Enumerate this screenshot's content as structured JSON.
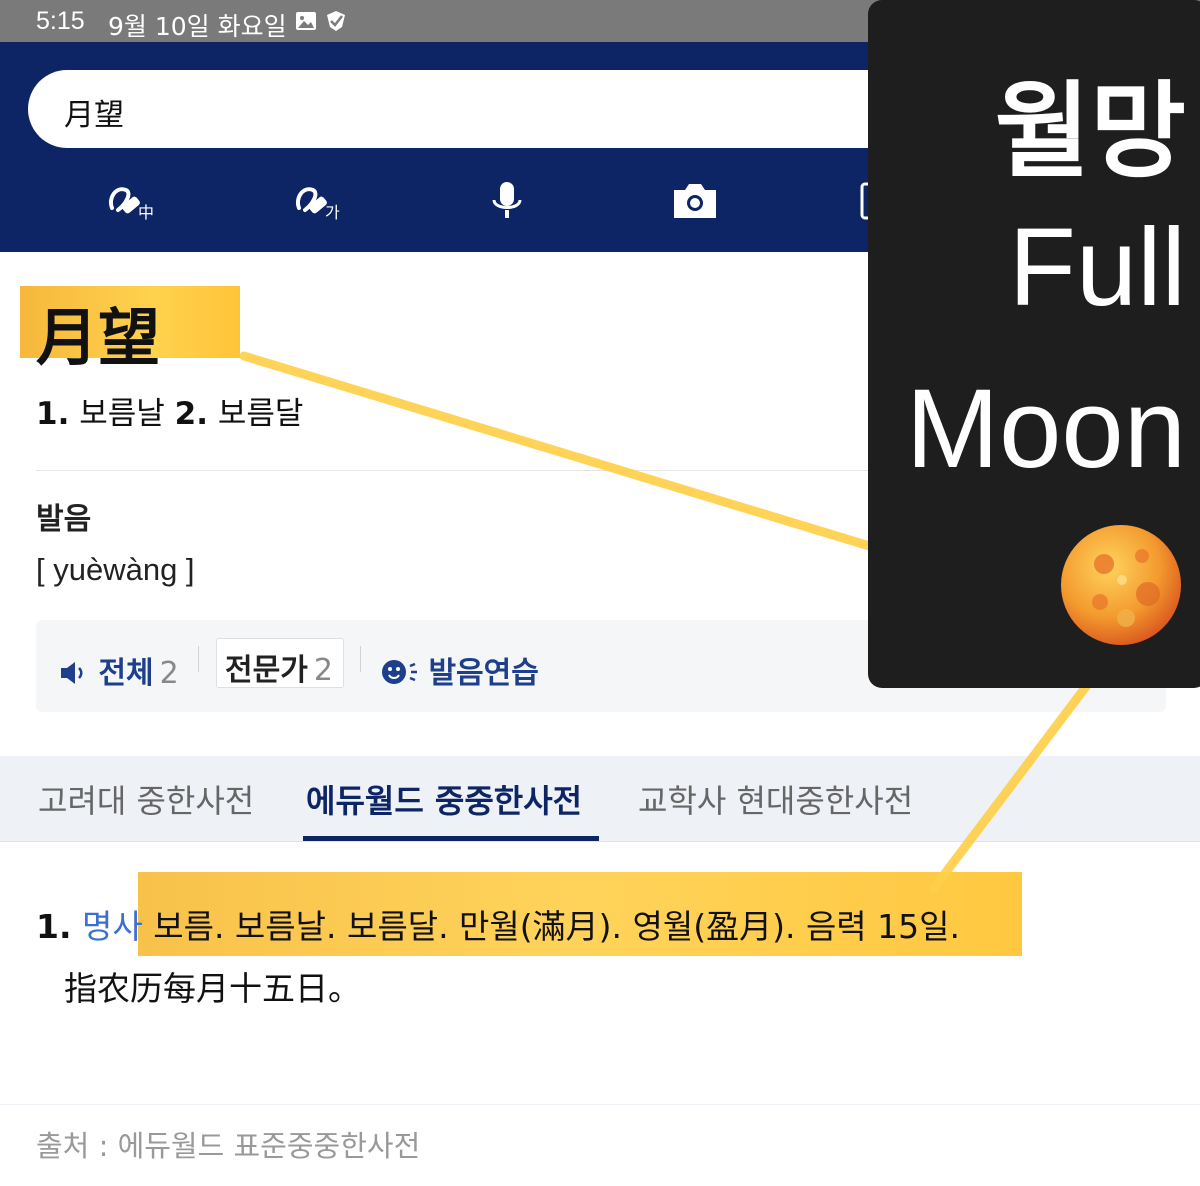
{
  "status_bar": {
    "time": "5:15",
    "date": "9월 10일 화요일"
  },
  "search": {
    "query": "月望"
  },
  "toolbar": [
    "handwriting-chinese-icon",
    "handwriting-korean-icon",
    "microphone-icon",
    "camera-icon"
  ],
  "entry": {
    "headword": "月望",
    "sense1_num": "1.",
    "sense1": "보름날",
    "sense2_num": "2.",
    "sense2": "보름달",
    "pron_title": "발음",
    "pinyin": "[ yuèwàng ]",
    "pron_all_label": "전체",
    "pron_all_count": "2",
    "pron_expert_label": "전문가",
    "pron_expert_count": "2",
    "pron_practice_label": "발음연습"
  },
  "tabs": [
    {
      "label": "고려대 중한사전",
      "active": false
    },
    {
      "label": "에듀월드 중중한사전",
      "active": true
    },
    {
      "label": "교학사 현대중한사전",
      "active": false
    }
  ],
  "definition": {
    "num": "1.",
    "pos": "명사",
    "text": "보름. 보름날. 보름달. 만월(滿月). 영월(盈月). 음력 15일.",
    "chinese": "指农历每月十五日。"
  },
  "source": "출처 : 에듀월드 표준중중한사전",
  "overlay": {
    "korean": "월망",
    "line1": "Full",
    "line2": "Moon"
  },
  "colors": {
    "header": "#0d2565",
    "highlight": "#ffc840",
    "panel": "#1e1e1e"
  }
}
